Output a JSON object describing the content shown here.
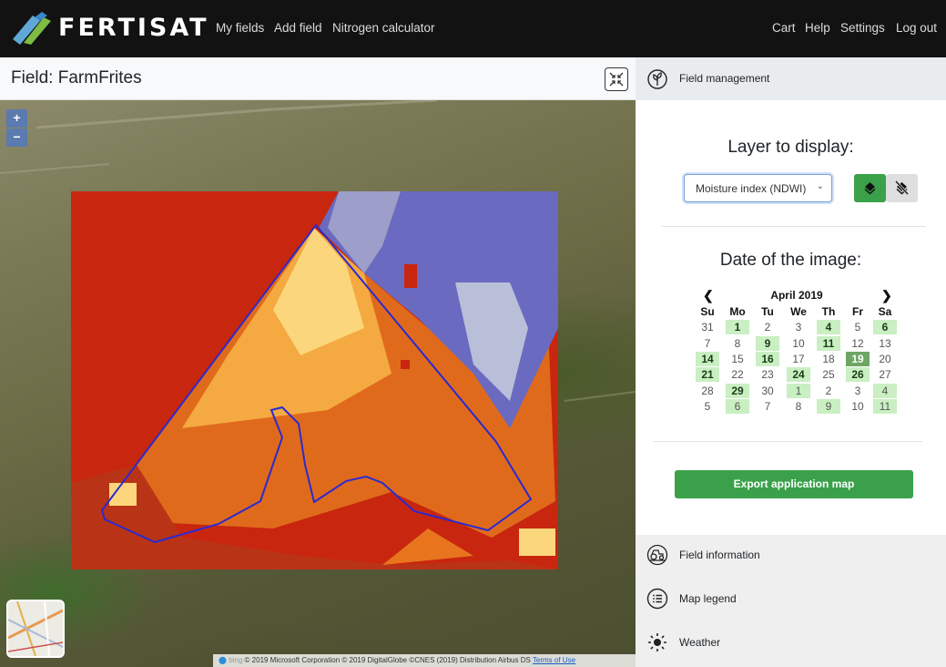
{
  "app": {
    "brand": "FERTISAT",
    "nav": [
      "My fields",
      "Add field",
      "Nitrogen calculator"
    ],
    "right_nav": [
      "Cart",
      "Help",
      "Settings",
      "Log out"
    ]
  },
  "field": {
    "title": "Field: FarmFrites"
  },
  "map": {
    "zoom_in": "+",
    "zoom_out": "−",
    "attribution_brand": "bing",
    "attribution": "© 2019 Microsoft Corporation © 2019 DigitalGlobe ©CNES (2019) Distribution Airbus DS",
    "terms": "Terms of Use"
  },
  "panel": {
    "management_label": "Field management",
    "layer_title": "Layer to display:",
    "layer_selected": "Moisture index (NDWI)",
    "date_title": "Date of the image:",
    "export_label": "Export application map",
    "sections": [
      "Field information",
      "Map legend",
      "Weather"
    ]
  },
  "calendar": {
    "month": "April 2019",
    "prev": "‹",
    "next": "›",
    "weekdays": [
      "Su",
      "Mo",
      "Tu",
      "We",
      "Th",
      "Fr",
      "Sa"
    ],
    "weeks": [
      [
        "31",
        "1",
        "2",
        "3",
        "4",
        "5",
        "6"
      ],
      [
        "7",
        "8",
        "9",
        "10",
        "11",
        "12",
        "13"
      ],
      [
        "14",
        "15",
        "16",
        "17",
        "18",
        "19",
        "20"
      ],
      [
        "21",
        "22",
        "23",
        "24",
        "25",
        "26",
        "27"
      ],
      [
        "28",
        "29",
        "30",
        "1",
        "2",
        "3",
        "4"
      ],
      [
        "5",
        "6",
        "7",
        "8",
        "9",
        "10",
        "11"
      ]
    ],
    "available_current": [
      "1",
      "4",
      "6",
      "9",
      "11",
      "14",
      "16",
      "21",
      "24",
      "26",
      "29"
    ],
    "available_next_month": [
      "1",
      "4",
      "6",
      "9",
      "11"
    ],
    "selected": "19"
  },
  "colors": {
    "accent_green": "#3aa14a",
    "topbar": "#121212",
    "moisture_low": "#c8260f",
    "moisture_high": "#6a6ac0"
  }
}
